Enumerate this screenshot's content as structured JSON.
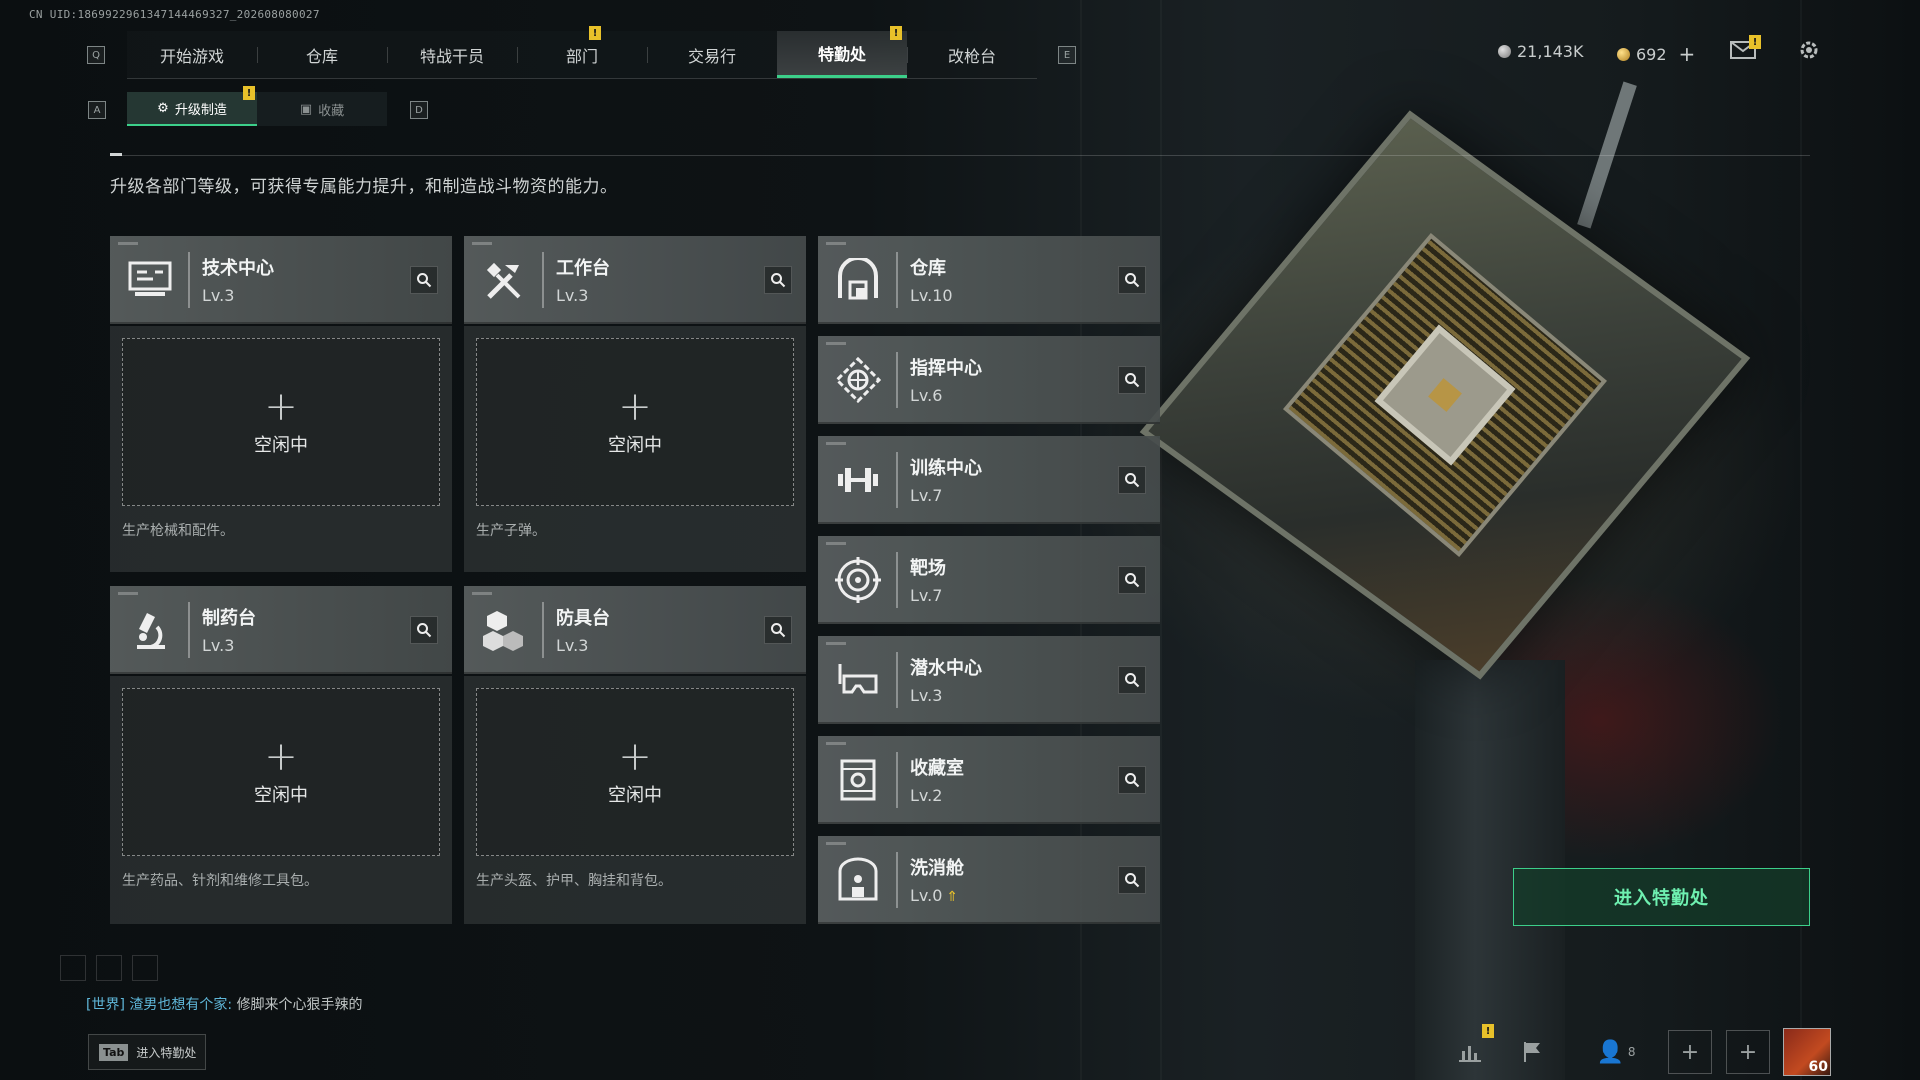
{
  "uid_text": "CN UID:1869922961347144469327_202608080027",
  "nav": {
    "left_key": "Q",
    "right_key": "E",
    "tabs": [
      {
        "label": "开始游戏"
      },
      {
        "label": "仓库"
      },
      {
        "label": "特战干员"
      },
      {
        "label": "部门",
        "badge": "!"
      },
      {
        "label": "交易行"
      },
      {
        "label": "特勤处",
        "active": true,
        "badge": "!"
      },
      {
        "label": "改枪台"
      }
    ]
  },
  "currency": {
    "silver": "21,143K",
    "gold": "692",
    "gold_plus": "+"
  },
  "subnav": {
    "left_key": "A",
    "right_key": "D",
    "tabs": [
      {
        "label": "升级制造",
        "active": true,
        "badge": "!"
      },
      {
        "label": "收藏"
      }
    ]
  },
  "intro": "升级各部门等级，可获得专属能力提升，和制造战斗物资的能力。",
  "production": [
    {
      "name": "技术中心",
      "level": "Lv.3",
      "icon": "monitor-icon",
      "slot_plus": "+",
      "slot_status": "空闲中",
      "desc": "生产枪械和配件。"
    },
    {
      "name": "工作台",
      "level": "Lv.3",
      "icon": "tools-icon",
      "slot_plus": "+",
      "slot_status": "空闲中",
      "desc": "生产子弹。"
    },
    {
      "name": "制药台",
      "level": "Lv.3",
      "icon": "microscope-icon",
      "slot_plus": "+",
      "slot_status": "空闲中",
      "desc": "生产药品、针剂和维修工具包。"
    },
    {
      "name": "防具台",
      "level": "Lv.3",
      "icon": "cubes-icon",
      "slot_plus": "+",
      "slot_status": "空闲中",
      "desc": "生产头盔、护甲、胸挂和背包。"
    }
  ],
  "facilities": [
    {
      "name": "仓库",
      "level": "Lv.10",
      "icon": "warehouse-icon"
    },
    {
      "name": "指挥中心",
      "level": "Lv.6",
      "icon": "command-icon"
    },
    {
      "name": "训练中心",
      "level": "Lv.7",
      "icon": "dumbbell-icon"
    },
    {
      "name": "靶场",
      "level": "Lv.7",
      "icon": "target-icon"
    },
    {
      "name": "潜水中心",
      "level": "Lv.3",
      "icon": "diving-mask-icon"
    },
    {
      "name": "收藏室",
      "level": "Lv.2",
      "icon": "collection-icon"
    },
    {
      "name": "洗消舱",
      "level": "Lv.0",
      "icon": "decon-icon",
      "upgrade": true
    }
  ],
  "enter_button": "进入特勤处",
  "chat": {
    "channel": "[世界]",
    "sender": "渣男也想有个家:",
    "message": "修脚来个心狠手辣的"
  },
  "tab_hint": {
    "key": "Tab",
    "label": "进入特勤处"
  },
  "bottom": {
    "friends_count": "8",
    "avatar_level": "60",
    "stats_badge": "!"
  },
  "colors": {
    "accent": "#3ccf8a",
    "badge": "#e8c12a",
    "chat_channel": "#5fb6d8"
  }
}
